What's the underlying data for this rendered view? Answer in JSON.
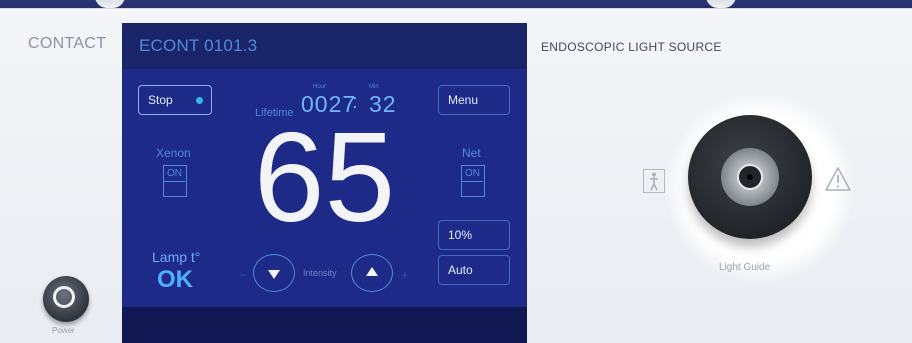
{
  "device": {
    "contact_label": "CONTACT",
    "power_label": "Power"
  },
  "screen": {
    "title": "ECONT 0101.3",
    "stop_label": "Stop",
    "menu_label": "Menu",
    "lifetime_label": "Lifetime",
    "hour_label": "Hour",
    "min_label": "Min",
    "hours": "0027",
    "minutes": "32",
    "time_separator": ":",
    "intensity_value": "65",
    "xenon_label": "Xenon",
    "xenon_toggle": "ON",
    "net_label": "Net",
    "net_toggle": "ON",
    "lamp_label": "Lamp t°",
    "lamp_status": "OK",
    "intensity_label": "Intensity",
    "minus": "−",
    "plus": "+",
    "percent_label": "10%",
    "auto_label": "Auto"
  },
  "right_panel": {
    "title": "ENDOSCOPIC LIGHT SOURCE",
    "light_guide_label": "Light Guide",
    "icons": [
      "type-bf-icon",
      "warning-icon"
    ]
  },
  "colors": {
    "screen_bg": "#1d2a87",
    "accent": "#4f8bd8",
    "indicator": "#39b4f2"
  }
}
